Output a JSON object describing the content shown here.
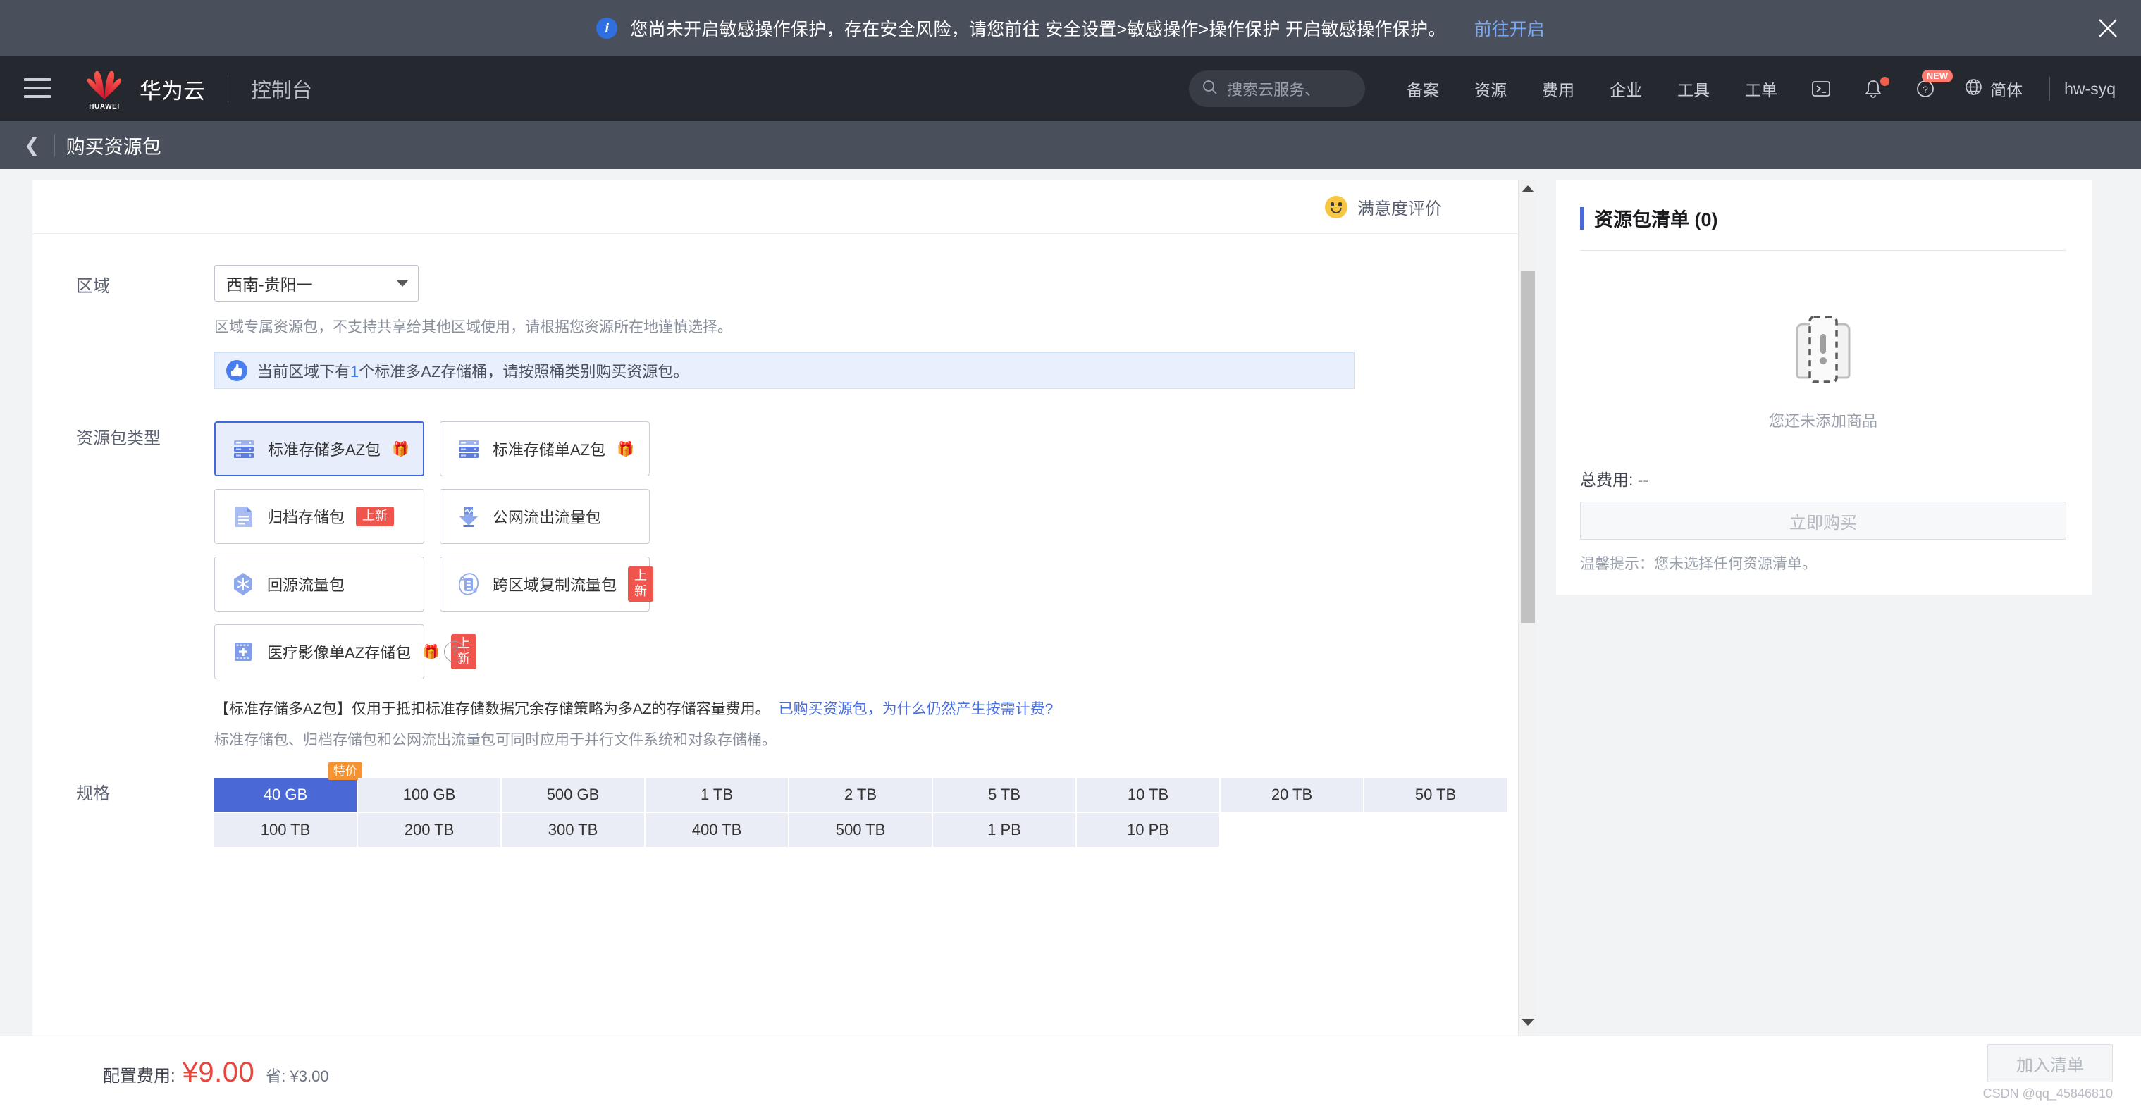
{
  "banner": {
    "icon": "info-icon",
    "message": "您尚未开启敏感操作保护，存在安全风险，请您前往 安全设置>敏感操作>操作保护 开启敏感操作保护。",
    "link": "前往开启",
    "close_icon": "close-icon"
  },
  "navbar": {
    "menu_icon": "hamburger-icon",
    "logo_icon": "huawei-logo-icon",
    "logo_word": "HUAWEI",
    "brand": "华为云",
    "console": "控制台",
    "search": {
      "icon": "search-icon",
      "placeholder": "搜索云服务、"
    },
    "items": [
      {
        "label": "备案"
      },
      {
        "label": "资源"
      },
      {
        "label": "费用"
      },
      {
        "label": "企业"
      },
      {
        "label": "工具"
      },
      {
        "label": "工单"
      }
    ],
    "terminal_icon": "terminal-icon",
    "bell_icon": "bell-icon",
    "help_icon": "help-icon",
    "help_badge": "NEW",
    "globe_icon": "globe-icon",
    "language": "简体",
    "user": "hw-syq"
  },
  "page_header": {
    "back_icon": "back-chevron-icon",
    "title": "购买资源包"
  },
  "rating": {
    "icon": "smiley-icon",
    "label": "满意度评价"
  },
  "form": {
    "region": {
      "label": "区域",
      "value": "西南-贵阳一",
      "caret_icon": "chevron-down-icon",
      "hint": "区域专属资源包，不支持共享给其他区域使用，请根据您资源所在地谨慎选择。"
    },
    "tip": {
      "icon": "thumbs-up-icon",
      "prefix": "当前区域下有",
      "count": "1",
      "suffix": "个标准多AZ存储桶，请按照桶类别购买资源包。"
    },
    "package_type": {
      "label": "资源包类型",
      "cards": [
        {
          "name": "标准存储多AZ包",
          "icon": "server-stack-icon",
          "gift": true,
          "gift_icon": "gift-icon",
          "badge": "",
          "selected": true
        },
        {
          "name": "标准存储单AZ包",
          "icon": "server-stack-icon",
          "gift": true,
          "gift_icon": "gift-icon",
          "badge": "",
          "selected": false
        },
        {
          "name": "归档存储包",
          "icon": "archive-file-icon",
          "gift": false,
          "gift_icon": "",
          "badge": "上新",
          "selected": false
        },
        {
          "name": "公网流出流量包",
          "icon": "download-arrow-icon",
          "gift": false,
          "gift_icon": "",
          "badge": "",
          "selected": false
        },
        {
          "name": "回源流量包",
          "icon": "origin-traffic-icon",
          "gift": false,
          "gift_icon": "",
          "badge": "",
          "selected": false
        },
        {
          "name": "跨区域复制流量包",
          "icon": "cross-region-replication-icon",
          "gift": false,
          "gift_icon": "",
          "badge": "上新",
          "selected": false
        },
        {
          "name": "医疗影像单AZ存储包",
          "icon": "medical-image-icon",
          "gift": true,
          "gift_icon": "gift-icon",
          "badge": "上新",
          "selected": false
        }
      ],
      "help_icon": "question-mark-icon",
      "desc_main": "【标准存储多AZ包】仅用于抵扣标准存储数据冗余存储策略为多AZ的存储容量费用。",
      "desc_link": "已购买资源包，为什么仍然产生按需计费?",
      "desc_sub": "标准存储包、归档存储包和公网流出流量包可同时应用于并行文件系统和对象存储桶。"
    },
    "spec": {
      "label": "规格",
      "sale_tag": "特价",
      "row1": [
        "40 GB",
        "100 GB",
        "500 GB",
        "1 TB",
        "2 TB",
        "5 TB",
        "10 TB",
        "20 TB",
        "50 TB"
      ],
      "row2": [
        "100 TB",
        "200 TB",
        "300 TB",
        "400 TB",
        "500 TB",
        "1 PB",
        "10 PB"
      ],
      "selected": "40 GB"
    }
  },
  "cart": {
    "title": "资源包清单 (0)",
    "empty_icon": "empty-box-exclamation-icon",
    "empty_text": "您还未添加商品",
    "total_label": "总费用: --",
    "buy_button": "立即购买",
    "warm_tip": "温馨提示：您未选择任何资源清单。"
  },
  "footer": {
    "fee_label": "配置费用:",
    "fee_amount": "¥9.00",
    "fee_save": "省: ¥3.00",
    "add_button": "加入清单",
    "watermark": "CSDN @qq_45846810"
  },
  "colors": {
    "accent": "#4a68d6",
    "price_red": "#e8453c",
    "badge_red": "#f0554d",
    "gift_orange": "#f08422",
    "nav_bg": "#25282f",
    "banner_bg": "#4a4f5c"
  }
}
